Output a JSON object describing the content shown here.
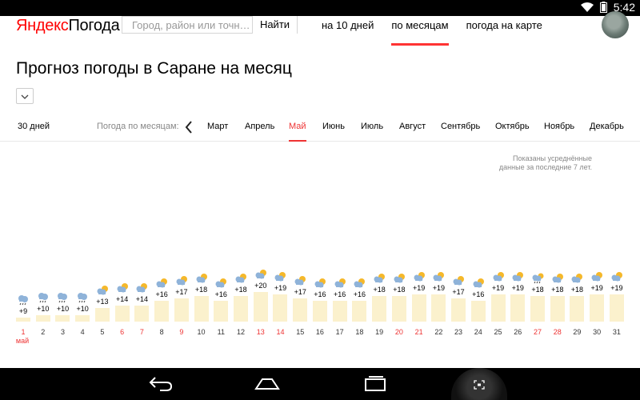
{
  "status_bar": {
    "time": "5:42"
  },
  "header": {
    "logo_ya": "Яндекс",
    "logo_rest": "Погода",
    "search_placeholder": "Город, район или точн…",
    "search_button": "Найти",
    "nav": [
      {
        "label": "на 10 дней",
        "active": false
      },
      {
        "label": "по месяцам",
        "active": true
      },
      {
        "label": "погода на карте",
        "active": false
      }
    ]
  },
  "page": {
    "title": "Прогноз погоды в Саране на месяц"
  },
  "tabs": {
    "days30": "30 дней",
    "by_month_label": "Погода по месяцам:",
    "months": [
      {
        "label": "Март",
        "active": false
      },
      {
        "label": "Апрель",
        "active": false
      },
      {
        "label": "Май",
        "active": true
      },
      {
        "label": "Июнь",
        "active": false
      },
      {
        "label": "Июль",
        "active": false
      },
      {
        "label": "Август",
        "active": false
      },
      {
        "label": "Сентябрь",
        "active": false
      },
      {
        "label": "Октябрь",
        "active": false
      },
      {
        "label": "Ноябрь",
        "active": false
      },
      {
        "label": "Декабрь",
        "active": false
      }
    ]
  },
  "note": {
    "line1": "Показаны усреднённые",
    "line2": "данные за последние 7 лет."
  },
  "chart_data": {
    "type": "bar",
    "month_label": "май",
    "days": [
      1,
      2,
      3,
      4,
      5,
      6,
      7,
      8,
      9,
      10,
      11,
      12,
      13,
      14,
      15,
      16,
      17,
      18,
      19,
      20,
      21,
      22,
      23,
      24,
      25,
      26,
      27,
      28,
      29,
      30,
      31
    ],
    "values": [
      9,
      10,
      10,
      10,
      13,
      14,
      14,
      16,
      17,
      18,
      16,
      18,
      20,
      19,
      17,
      16,
      16,
      16,
      18,
      18,
      19,
      19,
      17,
      16,
      19,
      19,
      18,
      18,
      18,
      19,
      19
    ],
    "labels": [
      "+9",
      "+10",
      "+10",
      "+10",
      "+13",
      "+14",
      "+14",
      "+16",
      "+17",
      "+18",
      "+16",
      "+18",
      "+20",
      "+19",
      "+17",
      "+16",
      "+16",
      "+16",
      "+18",
      "+18",
      "+19",
      "+19",
      "+17",
      "+16",
      "+19",
      "+19",
      "+18",
      "+18",
      "+18",
      "+19",
      "+19"
    ],
    "icons": [
      "rain-icon",
      "rain-icon",
      "rain-icon",
      "rain-icon",
      "partly-cloudy-icon",
      "partly-cloudy-icon",
      "partly-cloudy-icon",
      "partly-cloudy-icon",
      "partly-cloudy-icon",
      "partly-cloudy-icon",
      "partly-cloudy-icon",
      "partly-cloudy-icon",
      "partly-cloudy-icon",
      "partly-cloudy-icon",
      "partly-cloudy-icon",
      "partly-cloudy-icon",
      "partly-cloudy-icon",
      "partly-cloudy-icon",
      "partly-cloudy-icon",
      "partly-cloudy-icon",
      "partly-cloudy-icon",
      "partly-cloudy-icon",
      "partly-cloudy-icon",
      "partly-cloudy-icon",
      "partly-cloudy-icon",
      "partly-cloudy-icon",
      "rain-sun-icon",
      "partly-cloudy-icon",
      "partly-cloudy-icon",
      "partly-cloudy-icon",
      "partly-cloudy-icon"
    ],
    "red_days": [
      1,
      6,
      7,
      9,
      13,
      14,
      20,
      21,
      27,
      28
    ],
    "ylim": [
      0,
      25
    ],
    "colors": {
      "bar": "#fbf1cd",
      "weekend": "#ee3333",
      "sun": "#f5b82a",
      "cloud": "#8fb3d9",
      "rain": "#444444"
    }
  }
}
